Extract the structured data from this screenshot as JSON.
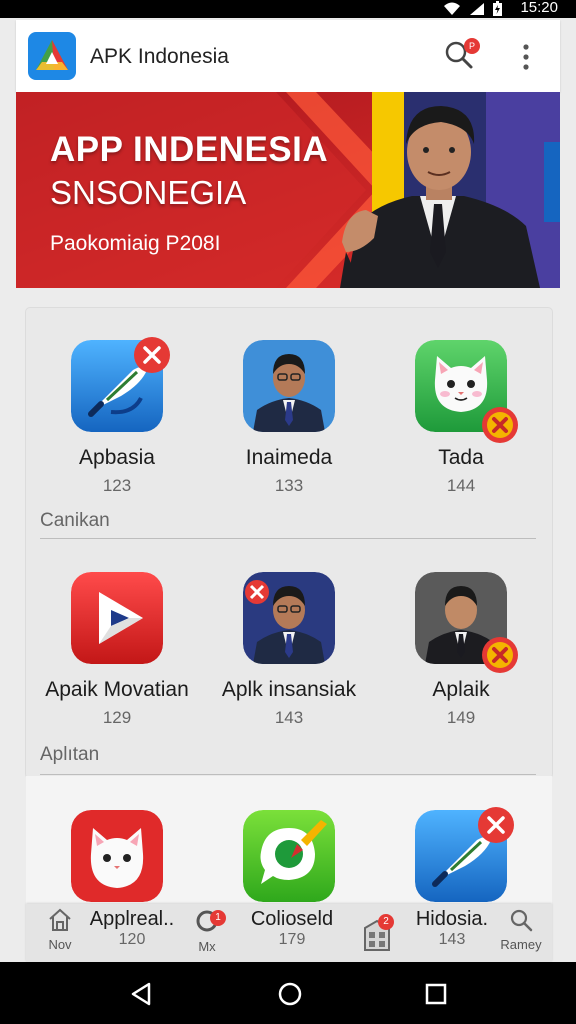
{
  "status": {
    "time": "15:20",
    "icons": [
      "wifi-icon",
      "signal-icon",
      "battery-icon"
    ]
  },
  "appbar": {
    "title": "APK Indonesia",
    "search_badge": "P",
    "icons": [
      "app-logo",
      "search-icon",
      "more-vert-icon"
    ]
  },
  "banner": {
    "title": "APP INDENESIA",
    "subtitle": "SNSONEGIA",
    "caption": "Paokomiaig P208I"
  },
  "sections": [
    {
      "label": "Canikan",
      "apps": [
        {
          "name": "Apbasia",
          "count": "123",
          "icon": "feather-pen-icon",
          "badge": "close-badge-red"
        },
        {
          "name": "Inaimeda",
          "count": "133",
          "icon": "person-portrait-icon",
          "badge": ""
        },
        {
          "name": "Tada",
          "count": "144",
          "icon": "cat-icon",
          "badge": "close-badge-orange"
        }
      ]
    },
    {
      "label": "Aplıtan",
      "apps": [
        {
          "name": "Apaik Movatian",
          "count": "129",
          "icon": "play-icon",
          "badge": ""
        },
        {
          "name": "Aplk insansiak",
          "count": "143",
          "icon": "person-portrait-icon",
          "badge": ""
        },
        {
          "name": "Aplaik",
          "count": "149",
          "icon": "person-portrait-icon",
          "badge": "close-badge-orange"
        }
      ]
    },
    {
      "label": "",
      "apps": [
        {
          "name": "",
          "count": "",
          "icon": "cat-icon"
        },
        {
          "name": "",
          "count": "",
          "icon": "chat-brush-icon"
        },
        {
          "name": "",
          "count": "",
          "icon": "feather-pen-icon",
          "badge": "close-badge-red"
        }
      ]
    }
  ],
  "bottomnav": {
    "home_label": "Nov",
    "item1_title": "Applreal..",
    "item1_count": "120",
    "mix_label": "Mx",
    "mix_badge": "1",
    "item2_title": "Colioseld",
    "item2_count": "179",
    "store_badge": "2",
    "item3_title": "Hidosia.",
    "item3_count": "143",
    "search_label": "Ramey"
  },
  "colors": {
    "accent_red": "#e53935",
    "badge_orange": "#f4b400",
    "banner_red": "#c9232a"
  }
}
